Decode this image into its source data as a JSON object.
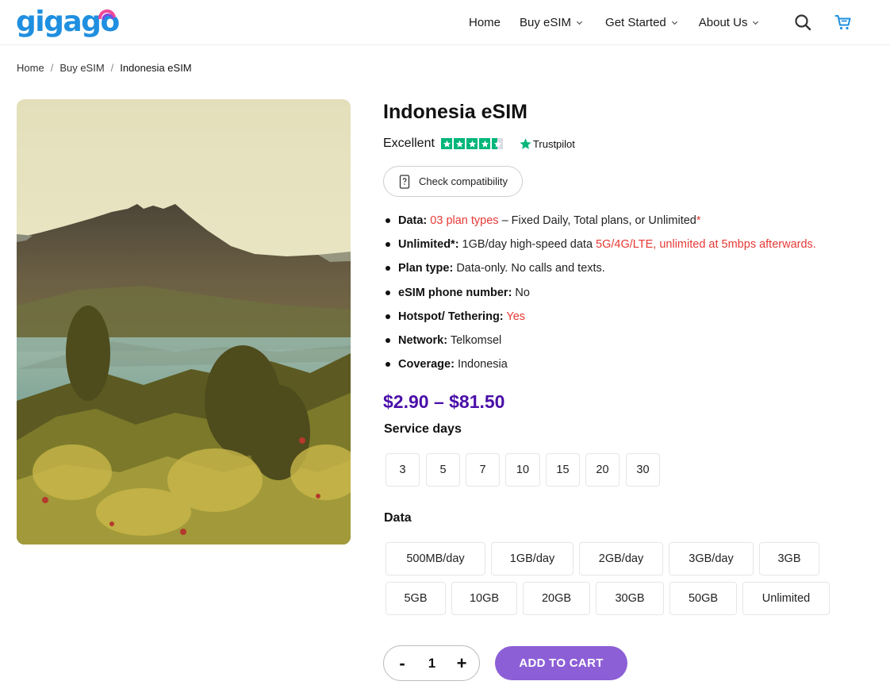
{
  "header": {
    "logo_text": "gigago",
    "nav": [
      {
        "label": "Home"
      },
      {
        "label": "Buy eSIM"
      },
      {
        "label": "Get Started"
      },
      {
        "label": "About Us"
      }
    ],
    "icons": {
      "search": "search-icon",
      "cart": "cart-icon"
    }
  },
  "breadcrumb": {
    "items": [
      "Home",
      "Buy eSIM",
      "Indonesia eSIM"
    ],
    "separator": "/"
  },
  "product": {
    "title": "Indonesia eSIM",
    "rating": {
      "word": "Excellent",
      "stars_value": 4.5,
      "stars_max": 5,
      "provider": "Trustpilot",
      "star_color": "#00b67a"
    },
    "compat_button": "Check compatibility",
    "specs": {
      "data": {
        "label": "Data:",
        "highlight": "03 plan types",
        "rest": " – Fixed Daily, Total plans, or Unlimited",
        "asterisk": "*"
      },
      "unlimited": {
        "label": "Unlimited*:",
        "rest": " 1GB/day high-speed data ",
        "highlight": "5G/4G/LTE, unlimited at 5mbps afterwards."
      },
      "plan_type": {
        "label": "Plan type:",
        "rest": " Data-only. No calls and texts."
      },
      "phone_number": {
        "label": "eSIM phone number:",
        "rest": " No"
      },
      "hotspot": {
        "label": "Hotspot/ Tethering:",
        "highlight": " Yes"
      },
      "network": {
        "label": "Network:",
        "rest": " Telkomsel"
      },
      "coverage": {
        "label": "Coverage:",
        "rest": " Indonesia"
      }
    },
    "price": "$2.90 – $81.50",
    "price_color": "#4a0fa8",
    "service_days_label": "Service days",
    "service_days": [
      "3",
      "5",
      "7",
      "10",
      "15",
      "20",
      "30"
    ],
    "data_label": "Data",
    "data_options": [
      "500MB/day",
      "1GB/day",
      "2GB/day",
      "3GB/day",
      "3GB",
      "5GB",
      "10GB",
      "20GB",
      "30GB",
      "50GB",
      "Unlimited"
    ],
    "quantity": {
      "minus": "-",
      "value": "1",
      "plus": "+"
    },
    "add_to_cart": "ADD TO CART",
    "accent_color": "#8c5fd6",
    "highlight_color": "#e53935"
  }
}
